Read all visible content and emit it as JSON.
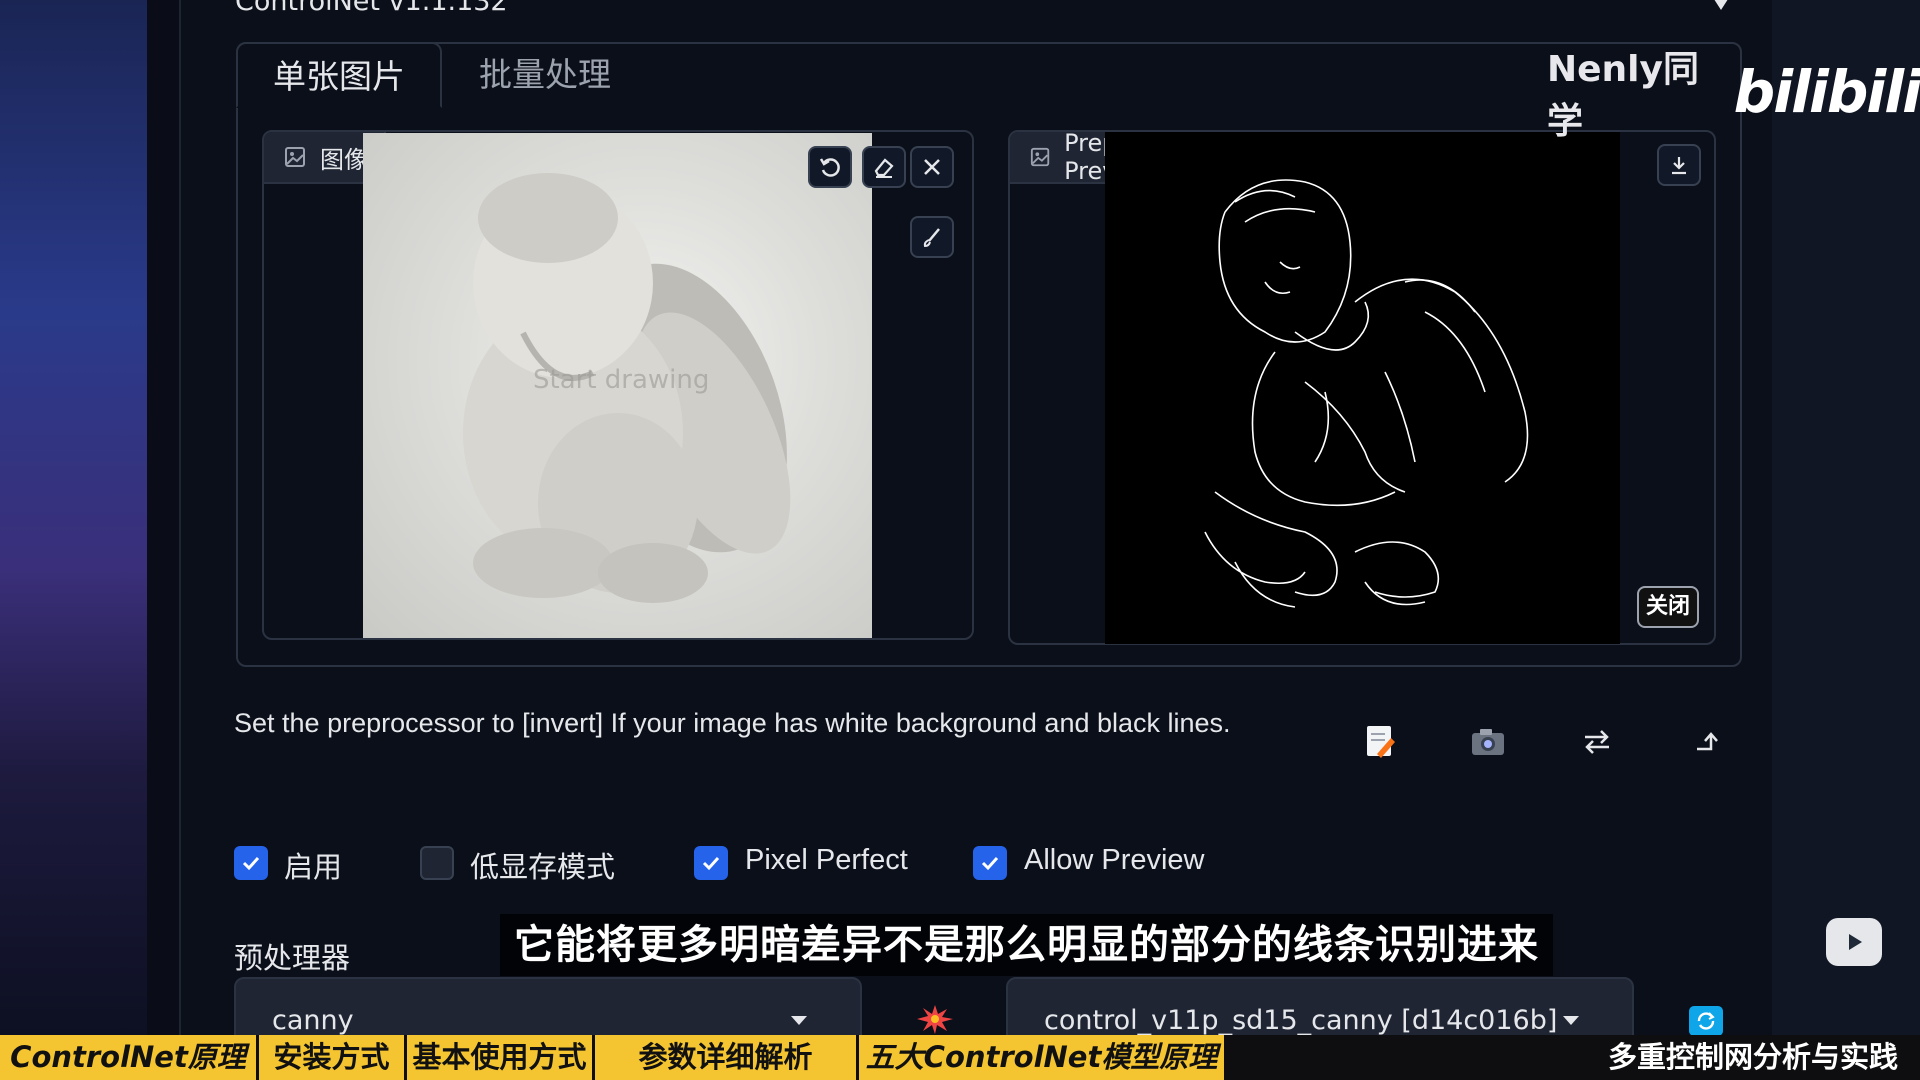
{
  "controlnet": {
    "title": "ControlNet v1.1.132"
  },
  "tabs": [
    {
      "label": "单张图片",
      "active": true
    },
    {
      "label": "批量处理",
      "active": false
    }
  ],
  "input_box": {
    "label": "图像",
    "watermark_text": "Start drawing"
  },
  "preview_box": {
    "label": "Preprocessor Preview",
    "close_label": "关闭"
  },
  "hint_text": "Set the preprocessor to [invert] If your image has white background and black lines.",
  "checkboxes": [
    {
      "label": "启用",
      "checked": true
    },
    {
      "label": "低显存模式",
      "checked": false
    },
    {
      "label": "Pixel Perfect",
      "checked": true
    },
    {
      "label": "Allow Preview",
      "checked": true
    }
  ],
  "preprocessor": {
    "section_label": "预处理器",
    "value": "canny"
  },
  "model": {
    "value": "control_v11p_sd15_canny [d14c016b]"
  },
  "subtitle": "它能将更多明暗差异不是那么明显的部分的线条识别进来",
  "watermark": {
    "author": "Nenly同学",
    "platform": "bilibili"
  },
  "chapters": [
    "ControlNet原理拆解",
    "安装方式",
    "基本使用方式",
    "参数详细解析",
    "五大ControlNet模型原理与应用",
    "多重控制网分析与实践"
  ],
  "colors": {
    "accent": "#2563eb",
    "chapter_bar": "#f4c531",
    "background": "#0b0f19"
  }
}
